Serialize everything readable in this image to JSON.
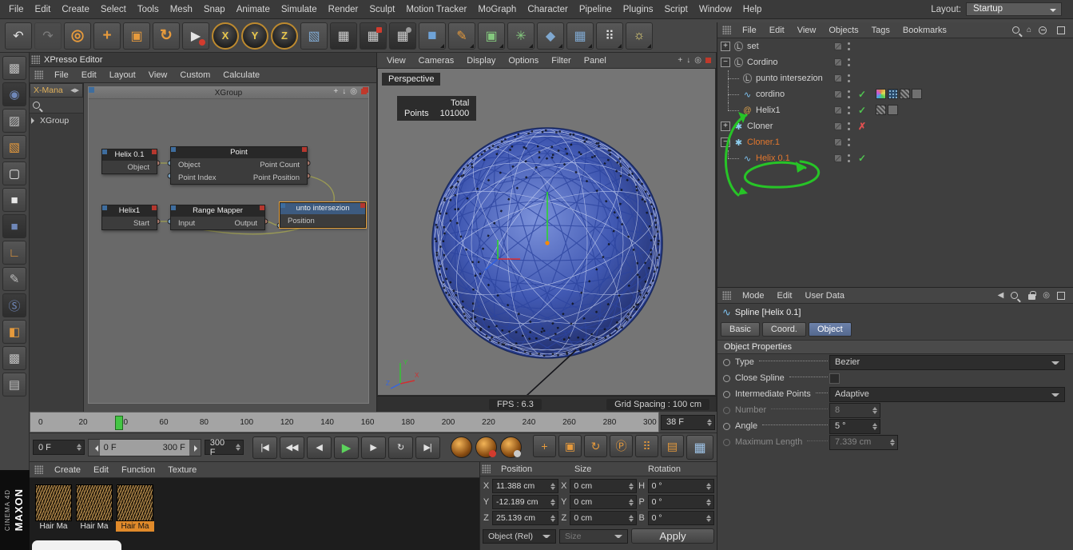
{
  "menubar": {
    "items": [
      "File",
      "Edit",
      "Create",
      "Select",
      "Tools",
      "Mesh",
      "Snap",
      "Animate",
      "Simulate",
      "Render",
      "Sculpt",
      "Motion Tracker",
      "MoGraph",
      "Character",
      "Pipeline",
      "Plugins",
      "Script",
      "Window",
      "Help"
    ],
    "layout_label": "Layout:",
    "layout_value": "Startup"
  },
  "toolbar": {
    "icons": [
      {
        "name": "undo-icon",
        "glyph": "↶",
        "cls": "g-dark"
      },
      {
        "name": "redo-icon",
        "glyph": "↷",
        "cls": "g-dark dim"
      },
      {
        "name": "live-selection-icon",
        "glyph": "◎",
        "cls": "g-orange big"
      },
      {
        "name": "move-icon",
        "glyph": "+",
        "cls": "g-orange big"
      },
      {
        "name": "scale-icon",
        "glyph": "▣",
        "cls": "g-orange"
      },
      {
        "name": "rotate-icon",
        "glyph": "↻",
        "cls": "g-orange big"
      },
      {
        "name": "last-tool-icon",
        "glyph": "▶",
        "cls": "g-light reddot"
      },
      {
        "name": "lock-x-axis-icon",
        "glyph": "X",
        "cls": "axis"
      },
      {
        "name": "lock-y-axis-icon",
        "glyph": "Y",
        "cls": "axis"
      },
      {
        "name": "lock-z-axis-icon",
        "glyph": "Z",
        "cls": "axis"
      },
      {
        "name": "coordinate-system-icon",
        "glyph": "▧",
        "cls": "g-blue"
      },
      {
        "name": "render-view-icon",
        "glyph": "▦",
        "cls": "g-clap"
      },
      {
        "name": "render-picture-viewer-icon",
        "glyph": "▦",
        "cls": "g-clap red"
      },
      {
        "name": "edit-render-settings-icon",
        "glyph": "▦",
        "cls": "g-clap gear"
      },
      {
        "name": "add-cube-icon",
        "glyph": "■",
        "cls": "g-cube more"
      },
      {
        "name": "add-spline-icon",
        "glyph": "✎",
        "cls": "g-orange more"
      },
      {
        "name": "mograph-icon",
        "glyph": "▣",
        "cls": "g-green more"
      },
      {
        "name": "simulate-icon",
        "glyph": "✳",
        "cls": "g-green more"
      },
      {
        "name": "volume-icon",
        "glyph": "◆",
        "cls": "g-blue more"
      },
      {
        "name": "scene-nodes-icon",
        "glyph": "▦",
        "cls": "g-blue more"
      },
      {
        "name": "camera-icon",
        "glyph": "⠿",
        "cls": "g-light more"
      },
      {
        "name": "light-icon",
        "glyph": "☼",
        "cls": "g-yellow more"
      }
    ]
  },
  "left_toolbar": {
    "icons": [
      {
        "name": "make-editable-icon",
        "glyph": "▩",
        "cls": "lt-gray"
      },
      {
        "name": "points-mode-icon",
        "glyph": "◉",
        "cls": "lt-dark"
      },
      {
        "name": "edges-mode-icon",
        "glyph": "▨",
        "cls": "lt-gray"
      },
      {
        "name": "polygons-mode-icon",
        "glyph": "▧",
        "cls": "lt-orange"
      },
      {
        "name": "tweak-mode-icon",
        "glyph": "▢",
        "cls": "lt-light"
      },
      {
        "name": "model-mode-icon",
        "glyph": "■",
        "cls": "lt-light"
      },
      {
        "name": "texture-mode-icon",
        "glyph": "■",
        "cls": "lt-dark"
      },
      {
        "name": "workplane-icon",
        "glyph": "∟",
        "cls": "lt-orange"
      },
      {
        "name": "uv-mode-icon",
        "glyph": "✎",
        "cls": "lt-gray"
      },
      {
        "name": "snap-icon",
        "glyph": "Ⓢ",
        "cls": "lt-dark"
      },
      {
        "name": "paint-icon",
        "glyph": "◧",
        "cls": "lt-orange"
      },
      {
        "name": "lock-workplane-icon",
        "glyph": "▩",
        "cls": "lt-gray"
      },
      {
        "name": "layer-icon",
        "glyph": "▤",
        "cls": "lt-gray"
      }
    ]
  },
  "xpresso": {
    "title": "XPresso Editor",
    "menu": [
      "File",
      "Edit",
      "Layout",
      "View",
      "Custom",
      "Calculate"
    ],
    "sidebar_tab": "X-Mana",
    "tree_item": "XGroup",
    "group_title": "XGroup",
    "nodes": {
      "helix01": {
        "title": "Helix 0.1",
        "port": "Object"
      },
      "point": {
        "title": "Point",
        "in1": "Object",
        "in2": "Point Index",
        "out1": "Point Count",
        "out2": "Point Position"
      },
      "helix1": {
        "title": "Helix1",
        "port": "Start"
      },
      "range_mapper": {
        "title": "Range Mapper",
        "in1": "Input",
        "out1": "Output"
      },
      "punto": {
        "title": "unto intersezion",
        "in1": "Position"
      }
    }
  },
  "viewport": {
    "menu": [
      "View",
      "Cameras",
      "Display",
      "Options",
      "Filter",
      "Panel"
    ],
    "camera_label": "Perspective",
    "stats_header": "Total",
    "stats_row_label": "Points",
    "stats_row_value": "101000",
    "fps": "FPS : 6.3",
    "grid_spacing": "Grid Spacing : 100 cm"
  },
  "object_manager": {
    "menu": [
      "File",
      "Edit",
      "View",
      "Objects",
      "Tags",
      "Bookmarks"
    ],
    "rows": [
      {
        "exp": "+",
        "name": "set",
        "check": ""
      },
      {
        "exp": "−",
        "name": "Cordino",
        "check": ""
      },
      {
        "name": "punto intersezion",
        "check": ""
      },
      {
        "name": "cordino",
        "check": "✓"
      },
      {
        "name": "Helix1",
        "check": "✓"
      },
      {
        "exp": "+",
        "name": "Cloner",
        "check": "✗"
      },
      {
        "exp": "−",
        "name": "Cloner.1",
        "check": ""
      },
      {
        "name": "Helix 0.1",
        "check": "✓"
      }
    ]
  },
  "attributes": {
    "menu": [
      "Mode",
      "Edit",
      "User Data"
    ],
    "object_title": "Spline [Helix 0.1]",
    "tabs": [
      "Basic",
      "Coord.",
      "Object"
    ],
    "section": "Object Properties",
    "rows": [
      {
        "label": "Type",
        "value": "Bezier"
      },
      {
        "label": "Close Spline",
        "value": ""
      },
      {
        "label": "Intermediate Points",
        "value": "Adaptive"
      },
      {
        "label": "Number",
        "value": "8"
      },
      {
        "label": "Angle",
        "value": "5 °"
      },
      {
        "label": "Maximum Length",
        "value": "7.339 cm"
      }
    ]
  },
  "timeline": {
    "ticks": [
      "0",
      "20",
      "40",
      "60",
      "80",
      "100",
      "120",
      "140",
      "160",
      "180",
      "200",
      "220",
      "240",
      "260",
      "280",
      "300"
    ],
    "marker": "38",
    "current": "38 F"
  },
  "transport": {
    "start": "0 F",
    "range_start": "0 F",
    "range_end": "300 F",
    "end": "300 F",
    "buttons": [
      {
        "name": "go-to-start-icon",
        "glyph": "|◀",
        "cls": ""
      },
      {
        "name": "play-backwards-icon",
        "glyph": "◀◀",
        "cls": ""
      },
      {
        "name": "previous-frame-icon",
        "glyph": "◀",
        "cls": ""
      },
      {
        "name": "play-forwards-icon",
        "glyph": "▶",
        "cls": "play"
      },
      {
        "name": "next-frame-icon",
        "glyph": "▶",
        "cls": ""
      },
      {
        "name": "loop-icon",
        "glyph": "↻",
        "cls": ""
      },
      {
        "name": "go-to-end-icon",
        "glyph": "▶|",
        "cls": ""
      }
    ],
    "record_buttons": [
      {
        "name": "record-position-icon",
        "glyph": "+",
        "cls": ""
      },
      {
        "name": "record-scale-icon",
        "glyph": "▣",
        "cls": ""
      },
      {
        "name": "record-rotation-icon",
        "glyph": "↻",
        "cls": ""
      },
      {
        "name": "record-parameter-icon",
        "glyph": "Ⓟ",
        "cls": ""
      },
      {
        "name": "keyframe-selection-icon",
        "glyph": "⠿",
        "cls": ""
      },
      {
        "name": "autokey-icon",
        "glyph": "▤",
        "cls": ""
      },
      {
        "name": "content-browser-icon",
        "glyph": "▦",
        "cls": "blue"
      }
    ]
  },
  "materials": {
    "menu": [
      "Create",
      "Edit",
      "Function",
      "Texture"
    ],
    "items": [
      "Hair Ma",
      "Hair Ma",
      "Hair Ma"
    ]
  },
  "coordinates": {
    "headers": [
      "Position",
      "Size",
      "Rotation"
    ],
    "position": [
      {
        "axis": "X",
        "value": "11.388 cm"
      },
      {
        "axis": "Y",
        "value": "-12.189 cm"
      },
      {
        "axis": "Z",
        "value": "25.139 cm"
      }
    ],
    "size": [
      {
        "axis": "X",
        "value": "0 cm"
      },
      {
        "axis": "Y",
        "value": "0 cm"
      },
      {
        "axis": "Z",
        "value": "0 cm"
      }
    ],
    "rotation": [
      {
        "axis": "H",
        "value": "0 °"
      },
      {
        "axis": "P",
        "value": "0 °"
      },
      {
        "axis": "B",
        "value": "0 °"
      }
    ],
    "mode": "Object (Rel)",
    "size_mode": "Size",
    "apply": "Apply"
  },
  "branding": {
    "maxon": "MAXON",
    "cinema": "CINEMA 4D"
  }
}
